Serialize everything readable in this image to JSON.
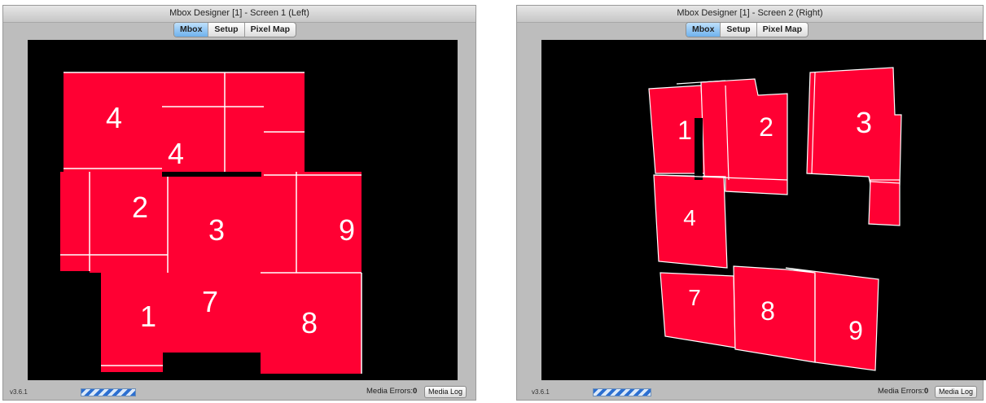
{
  "colors": {
    "panel": "#ff0033",
    "line": "#ffffff",
    "stage": "#000000"
  },
  "tab_labels": {
    "mbox": "Mbox",
    "setup": "Setup",
    "pixel_map": "Pixel Map"
  },
  "windows": {
    "left": {
      "title": "Mbox Designer [1] - Screen 1 (Left)",
      "version": "v3.6.1",
      "media_errors_label": "Media Errors:",
      "media_errors_value": "0",
      "media_log_label": "Media Log",
      "panel_labels": [
        "4",
        "4",
        "2",
        "3",
        "9",
        "1",
        "7",
        "8"
      ]
    },
    "right": {
      "title": "Mbox Designer [1] - Screen 2 (Right)",
      "version": "v3.6.1",
      "media_errors_label": "Media Errors:",
      "media_errors_value": "0",
      "media_log_label": "Media Log",
      "panel_labels": [
        "1",
        "2",
        "3",
        "4",
        "7",
        "8",
        "9"
      ]
    }
  }
}
